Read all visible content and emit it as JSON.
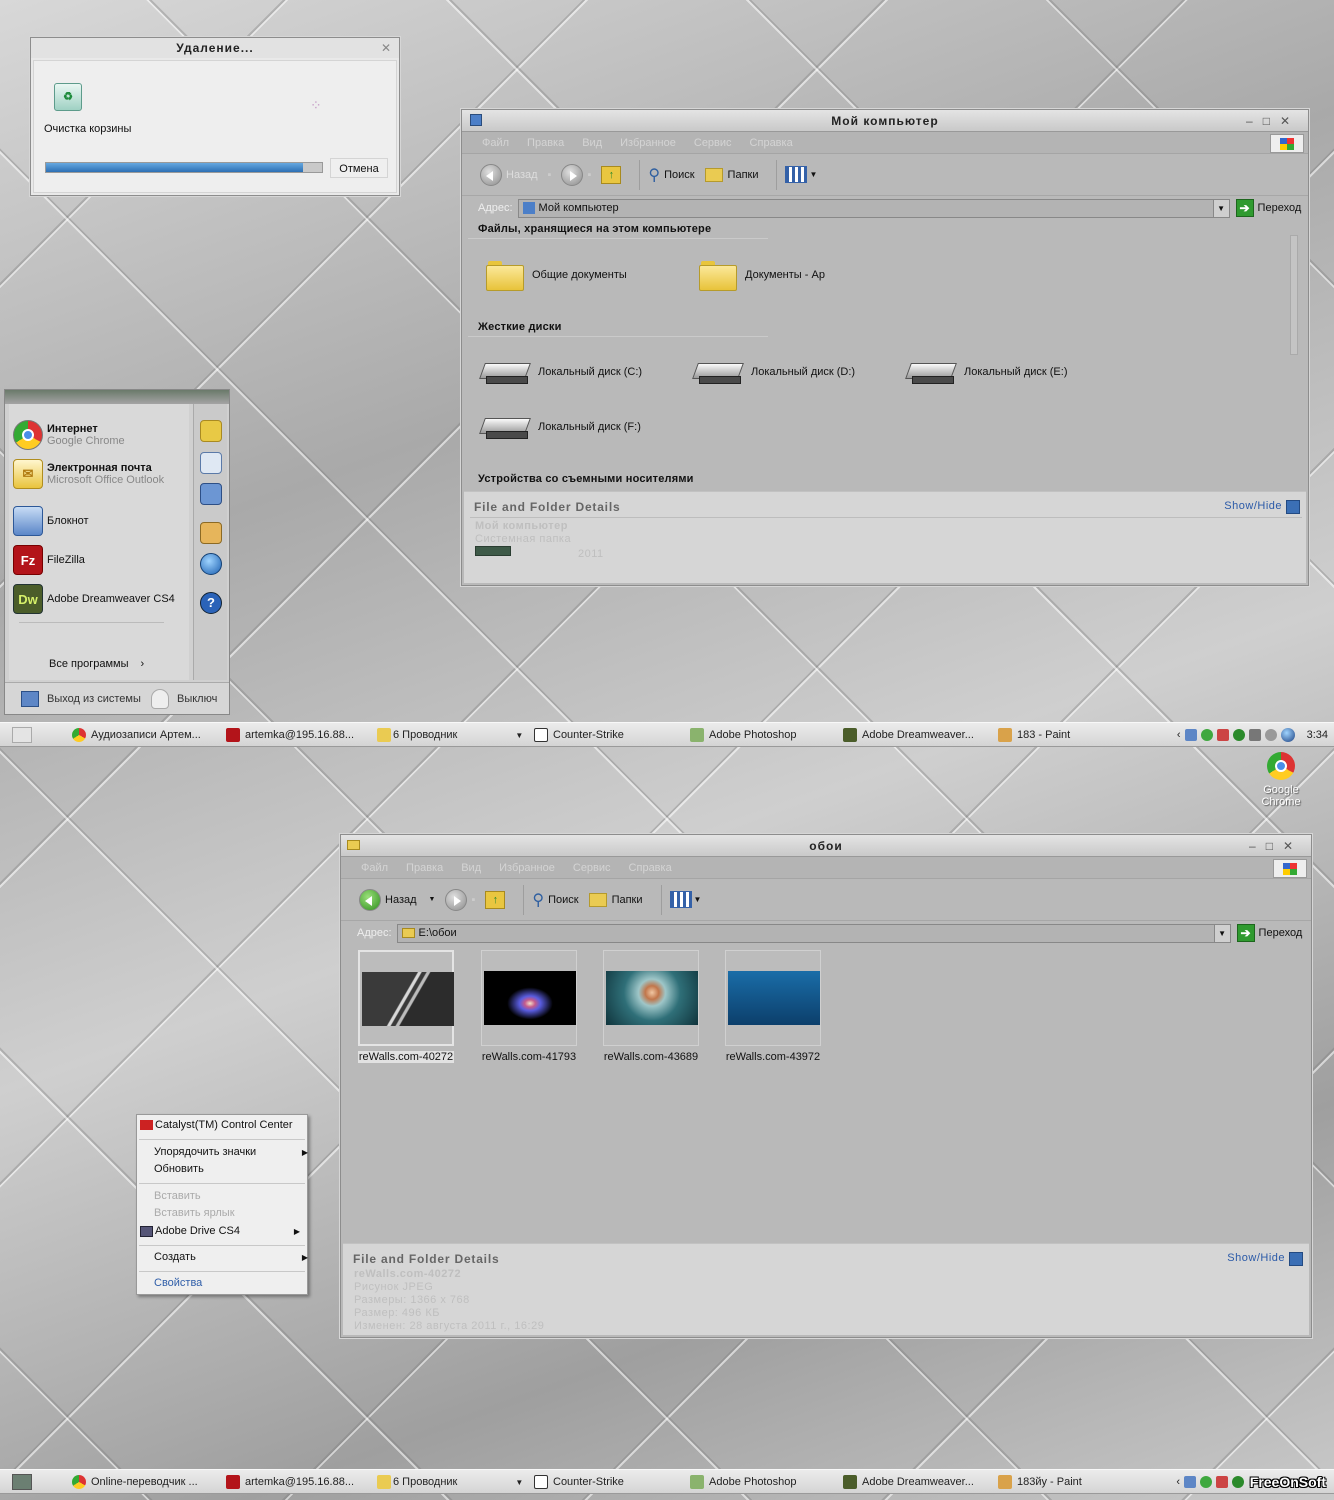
{
  "delete_dialog": {
    "title": "Удаление...",
    "action": "Очистка корзины",
    "progress": 0.93,
    "cancel": "Отмена"
  },
  "mycomp": {
    "title": "Мой компьютер",
    "menu": [
      "Файл",
      "Правка",
      "Вид",
      "Избранное",
      "Сервис",
      "Справка"
    ],
    "back": "Назад",
    "search": "Поиск",
    "folders": "Папки",
    "address_label": "Адрес:",
    "address_value": "Мой компьютер",
    "go": "Переход",
    "section_files": "Файлы, хранящиеся на этом компьютере",
    "shared_docs": "Общие документы",
    "docs_ap": "Документы - Ap",
    "section_disks": "Жесткие диски",
    "disks": [
      "Локальный диск (C:)",
      "Локальный диск (D:)",
      "Локальный диск (E:)",
      "Локальный диск (F:)"
    ],
    "section_removable": "Устройства со съемными носителями",
    "details_title": "File and Folder Details",
    "show_hide": "Show/Hide",
    "detail_name": "Мой компьютер",
    "detail_type": "Системная папка",
    "detail_year": "2011"
  },
  "startmenu": {
    "items": [
      {
        "title": "Интернет",
        "sub": "Google Chrome"
      },
      {
        "title": "Электронная почта",
        "sub": "Microsoft Office Outlook"
      },
      {
        "title": "Блокнот",
        "sub": ""
      },
      {
        "title": "FileZilla",
        "sub": ""
      },
      {
        "title": "Adobe Dreamweaver CS4",
        "sub": ""
      }
    ],
    "all_programs": "Все программы",
    "logout": "Выход из системы",
    "shutdown": "Выключ"
  },
  "taskbar1": {
    "items": [
      "Аудиозаписи Артем...",
      "artemka@195.16.88...",
      "6 Проводник",
      "Counter-Strike",
      "Adobe Photoshop",
      "Adobe Dreamweaver...",
      "183 - Paint"
    ],
    "clock": "3:34"
  },
  "taskbar2": {
    "items": [
      "Online-переводчик ...",
      "artemka@195.16.88...",
      "6 Проводник",
      "Counter-Strike",
      "Adobe Photoshop",
      "Adobe Dreamweaver...",
      "183йу - Paint"
    ],
    "watermark": "FreeOnSoft"
  },
  "desktop": {
    "chrome_icon": "Google Chrome"
  },
  "oboi": {
    "title": "обои",
    "menu": [
      "Файл",
      "Правка",
      "Вид",
      "Избранное",
      "Сервис",
      "Справка"
    ],
    "back": "Назад",
    "search": "Поиск",
    "folders": "Папки",
    "address_label": "Адрес:",
    "address_value": "E:\\обои",
    "go": "Переход",
    "files": [
      "reWalls.com-40272",
      "reWalls.com-41793",
      "reWalls.com-43689",
      "reWalls.com-43972"
    ],
    "details_title": "File and Folder Details",
    "show_hide": "Show/Hide",
    "details": [
      "reWalls.com-40272",
      "Рисунок JPEG",
      "Размеры: 1366 x 768",
      "Размер: 496 КБ",
      "Изменен: 28 августа 2011 г., 16:29"
    ]
  },
  "context_menu": {
    "catalyst": "Catalyst(TM) Control Center",
    "arrange": "Упорядочить значки",
    "refresh": "Обновить",
    "paste": "Вставить",
    "paste_shortcut": "Вставить ярлык",
    "adobe_drive": "Adobe Drive CS4",
    "create": "Создать",
    "properties": "Свойства"
  }
}
